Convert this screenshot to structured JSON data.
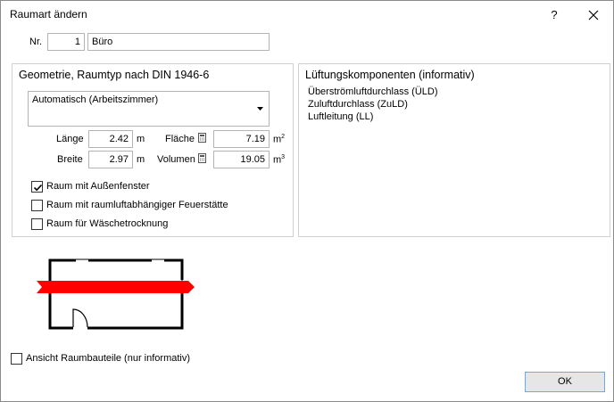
{
  "window": {
    "title": "Raumart ändern",
    "help_label": "?",
    "close_icon": "close-icon"
  },
  "header": {
    "nr_label": "Nr.",
    "nr_value": "1",
    "name_value": "Büro"
  },
  "geometry": {
    "title": "Geometrie, Raumtyp nach DIN 1946-6",
    "room_type": "Automatisch (Arbeitszimmer)",
    "laenge_label": "Länge",
    "laenge_value": "2.42",
    "laenge_unit": "m",
    "breite_label": "Breite",
    "breite_value": "2.97",
    "breite_unit": "m",
    "flaeche_label": "Fläche",
    "flaeche_value": "7.19",
    "flaeche_unit": "m",
    "flaeche_exp": "2",
    "volumen_label": "Volumen",
    "volumen_value": "19.05",
    "volumen_unit": "m",
    "volumen_exp": "3",
    "checkboxes": [
      {
        "label": "Raum mit Außenfenster",
        "checked": true
      },
      {
        "label": "Raum mit raumluftabhängiger Feuerstätte",
        "checked": false
      },
      {
        "label": "Raum für Wäschetrocknung",
        "checked": false
      }
    ]
  },
  "ventilation": {
    "title": "Lüftungskomponenten (informativ)",
    "items": [
      "Überströmluftdurchlass (ÜLD)",
      "Zuluftdurchlass (ZuLD)",
      "Luftleitung (LL)"
    ]
  },
  "footer": {
    "view_label": "Ansicht Raumbauteile  (nur informativ)",
    "view_checked": false,
    "ok_label": "OK"
  },
  "colors": {
    "accent": "#6aa8e8",
    "arrow": "#ff0000",
    "wall": "#000000"
  }
}
